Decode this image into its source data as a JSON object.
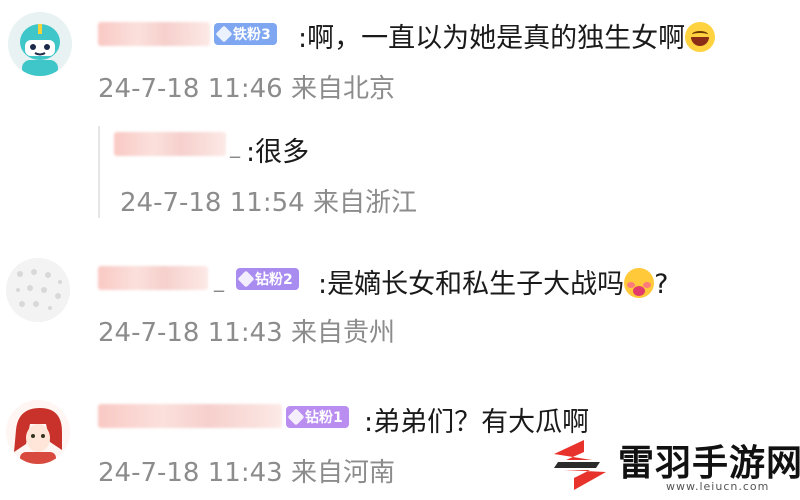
{
  "comments": [
    {
      "badge": "铁粉3",
      "badge_color": "#7fa6f0",
      "text": ":啊，一直以为她是真的独生女啊",
      "emoji": "laugh-emoji",
      "time": "24-7-18 11:46",
      "location": "来自北京"
    },
    {
      "underscore": "_",
      "text": ":很多",
      "time": "24-7-18 11:54",
      "location": "来自浙江"
    },
    {
      "underscore": "_",
      "badge": "钻粉2",
      "badge_color": "#a98cf0",
      "text": ":是嫡长女和私生子大战吗",
      "emoji": "shy-emoji",
      "text_after": "?",
      "time": "24-7-18 11:43",
      "location": "来自贵州"
    },
    {
      "badge": "钻粉1",
      "badge_color": "#b98ef0",
      "text": ":弟弟们？有大瓜啊",
      "time": "24-7-18 11:43",
      "location": "来自河南"
    }
  ],
  "watermark": {
    "name": "雷羽手游网",
    "url": "www.leiucn.com",
    "colors": {
      "mark": "#e8332c",
      "text": "#111111"
    }
  }
}
